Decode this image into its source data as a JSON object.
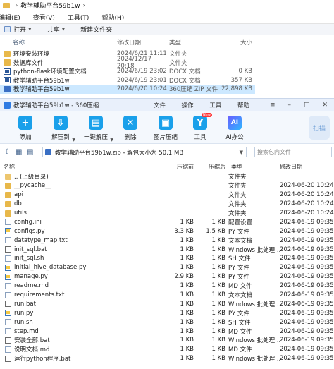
{
  "explorer": {
    "breadcrumb": "教学辅助平台59b1w",
    "menu": [
      "编辑(E)",
      "查看(V)",
      "工具(T)",
      "帮助(H)"
    ],
    "toolbar": {
      "open": "打开",
      "share": "共享",
      "new_folder": "新建文件夹"
    },
    "columns": [
      "名称",
      "修改日期",
      "类型",
      "大小"
    ],
    "rows": [
      {
        "name": "环境安装环境",
        "date": "2024/6/21 11:11",
        "type": "文件夹",
        "size": "",
        "icon": "folder"
      },
      {
        "name": "数据库文件",
        "date": "2024/12/17 20:18",
        "type": "文件夹",
        "size": "",
        "icon": "folder"
      },
      {
        "name": "python-flask环境配置文档",
        "date": "2024/6/19 23:02",
        "type": "DOCX 文档",
        "size": "0 KB",
        "icon": "doc"
      },
      {
        "name": "教学辅助平台59b1w",
        "date": "2024/6/19 23:01",
        "type": "DOCX 文档",
        "size": "357 KB",
        "icon": "doc"
      },
      {
        "name": "教学辅助平台59b1w",
        "date": "2024/6/20 10:24",
        "type": "360压缩 ZIP 文件",
        "size": "22,898 KB",
        "icon": "zip",
        "selected": true
      }
    ]
  },
  "zip": {
    "title": "教学辅助平台59b1w - 360压缩",
    "menu": [
      "文件",
      "操作",
      "工具",
      "帮助"
    ],
    "toolbar": {
      "add": "添加",
      "extract_to": "解压到",
      "one_click": "一键解压",
      "delete": "删除",
      "image_tools": "图片压缩",
      "tools": "工具",
      "ai": "AI办公",
      "scan": "扫描",
      "new_badge": "New"
    },
    "path": "教学辅助平台59b1w.zip - 解包大小为 50.1 MB",
    "search_placeholder": "搜索包内文件",
    "columns": [
      "名称",
      "压缩前",
      "压缩后",
      "类型",
      "修改日期"
    ],
    "rows": [
      {
        "name": ".. (上级目录)",
        "before": "",
        "after": "",
        "type": "文件夹",
        "date": "",
        "icon": "up"
      },
      {
        "name": "__pycache__",
        "before": "",
        "after": "",
        "type": "文件夹",
        "date": "2024-06-20 10:24",
        "icon": "folder"
      },
      {
        "name": "api",
        "before": "",
        "after": "",
        "type": "文件夹",
        "date": "2024-06-20 10:24",
        "icon": "folder"
      },
      {
        "name": "db",
        "before": "",
        "after": "",
        "type": "文件夹",
        "date": "2024-06-20 10:24",
        "icon": "folder"
      },
      {
        "name": "utils",
        "before": "",
        "after": "",
        "type": "文件夹",
        "date": "2024-06-20 10:24",
        "icon": "folder"
      },
      {
        "name": "config.ini",
        "before": "1 KB",
        "after": "1 KB",
        "type": "配置设置",
        "date": "2024-06-19 09:35",
        "icon": "file"
      },
      {
        "name": "configs.py",
        "before": "3.3 KB",
        "after": "1.5 KB",
        "type": "PY 文件",
        "date": "2024-06-19 09:35",
        "icon": "py"
      },
      {
        "name": "datatype_map.txt",
        "before": "1 KB",
        "after": "1 KB",
        "type": "文本文档",
        "date": "2024-06-19 09:35",
        "icon": "file"
      },
      {
        "name": "init_sql.bat",
        "before": "1 KB",
        "after": "1 KB",
        "type": "Windows 批处理...",
        "date": "2024-06-19 09:35",
        "icon": "bat"
      },
      {
        "name": "init_sql.sh",
        "before": "1 KB",
        "after": "1 KB",
        "type": "SH 文件",
        "date": "2024-06-19 09:35",
        "icon": "file"
      },
      {
        "name": "initial_hive_database.py",
        "before": "1 KB",
        "after": "1 KB",
        "type": "PY 文件",
        "date": "2024-06-19 09:35",
        "icon": "py"
      },
      {
        "name": "manage.py",
        "before": "2.9 KB",
        "after": "1 KB",
        "type": "PY 文件",
        "date": "2024-06-19 09:35",
        "icon": "py"
      },
      {
        "name": "readme.md",
        "before": "1 KB",
        "after": "1 KB",
        "type": "MD 文件",
        "date": "2024-06-19 09:35",
        "icon": "file"
      },
      {
        "name": "requirements.txt",
        "before": "1 KB",
        "after": "1 KB",
        "type": "文本文档",
        "date": "2024-06-19 09:35",
        "icon": "file"
      },
      {
        "name": "run.bat",
        "before": "1 KB",
        "after": "1 KB",
        "type": "Windows 批处理...",
        "date": "2024-06-19 09:35",
        "icon": "bat"
      },
      {
        "name": "run.py",
        "before": "1 KB",
        "after": "1 KB",
        "type": "PY 文件",
        "date": "2024-06-19 09:35",
        "icon": "py"
      },
      {
        "name": "run.sh",
        "before": "1 KB",
        "after": "1 KB",
        "type": "SH 文件",
        "date": "2024-06-19 09:35",
        "icon": "file"
      },
      {
        "name": "step.md",
        "before": "1 KB",
        "after": "1 KB",
        "type": "MD 文件",
        "date": "2024-06-19 09:35",
        "icon": "file"
      },
      {
        "name": "安装全部.bat",
        "before": "1 KB",
        "after": "1 KB",
        "type": "Windows 批处理...",
        "date": "2024-06-19 09:35",
        "icon": "bat"
      },
      {
        "name": "说明文档.md",
        "before": "1 KB",
        "after": "1 KB",
        "type": "MD 文件",
        "date": "2024-06-19 09:35",
        "icon": "file"
      },
      {
        "name": "运行python程序.bat",
        "before": "1 KB",
        "after": "1 KB",
        "type": "Windows 批处理...",
        "date": "2024-06-19 09:35",
        "icon": "bat"
      }
    ]
  }
}
